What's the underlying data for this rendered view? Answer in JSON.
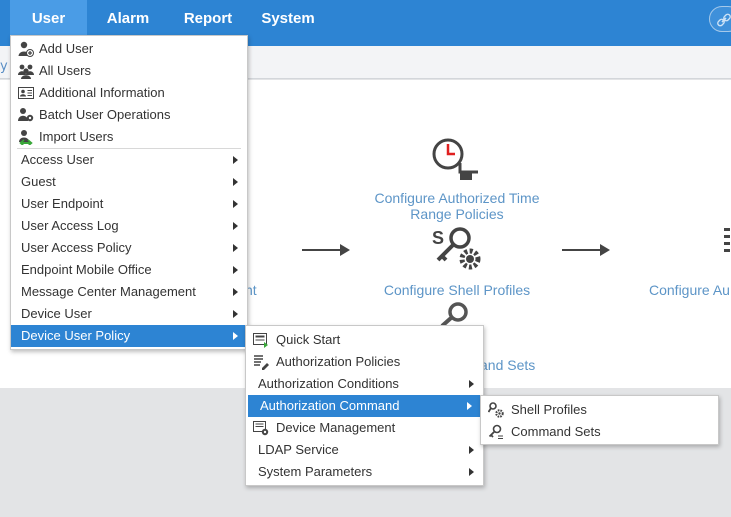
{
  "topnav": {
    "items": [
      {
        "label": "User"
      },
      {
        "label": "Alarm"
      },
      {
        "label": "Report"
      },
      {
        "label": "System"
      }
    ]
  },
  "breadcrumb": {
    "fragment": "y"
  },
  "flow": {
    "time_range": "Configure Authorized Time Range Policies",
    "shell_profiles": "Configure Shell Profiles",
    "left_fragment": "nt",
    "right_fragment": "Configure Au",
    "bottom_fragment": "and Sets"
  },
  "user_menu": {
    "top_items": [
      {
        "label": "Add User",
        "icon": "add-user-icon"
      },
      {
        "label": "All Users",
        "icon": "all-users-icon"
      },
      {
        "label": "Additional Information",
        "icon": "id-card-icon"
      },
      {
        "label": "Batch User Operations",
        "icon": "batch-users-icon"
      },
      {
        "label": "Import Users",
        "icon": "import-users-icon"
      }
    ],
    "sub_items": [
      {
        "label": "Access User"
      },
      {
        "label": "Guest"
      },
      {
        "label": "User Endpoint"
      },
      {
        "label": "User Access Log"
      },
      {
        "label": "User Access Policy"
      },
      {
        "label": "Endpoint Mobile Office"
      },
      {
        "label": "Message Center Management"
      },
      {
        "label": "Device User"
      },
      {
        "label": "Device User Policy",
        "active": true
      }
    ]
  },
  "device_policy_menu": {
    "items": [
      {
        "label": "Quick Start",
        "icon": "quick-start-icon"
      },
      {
        "label": "Authorization Policies",
        "icon": "policy-list-icon"
      },
      {
        "label": "Authorization Conditions",
        "submenu": true
      },
      {
        "label": "Authorization Command",
        "submenu": true,
        "active": true
      },
      {
        "label": "Device Management",
        "icon": "device-icon"
      },
      {
        "label": "LDAP Service",
        "submenu": true
      },
      {
        "label": "System Parameters",
        "submenu": true
      }
    ]
  },
  "auth_command_menu": {
    "items": [
      {
        "label": "Shell Profiles",
        "icon": "shell-profile-icon"
      },
      {
        "label": "Command Sets",
        "icon": "command-set-icon"
      }
    ]
  },
  "colors": {
    "accent": "#2d84d3",
    "link": "#5d95c7"
  }
}
